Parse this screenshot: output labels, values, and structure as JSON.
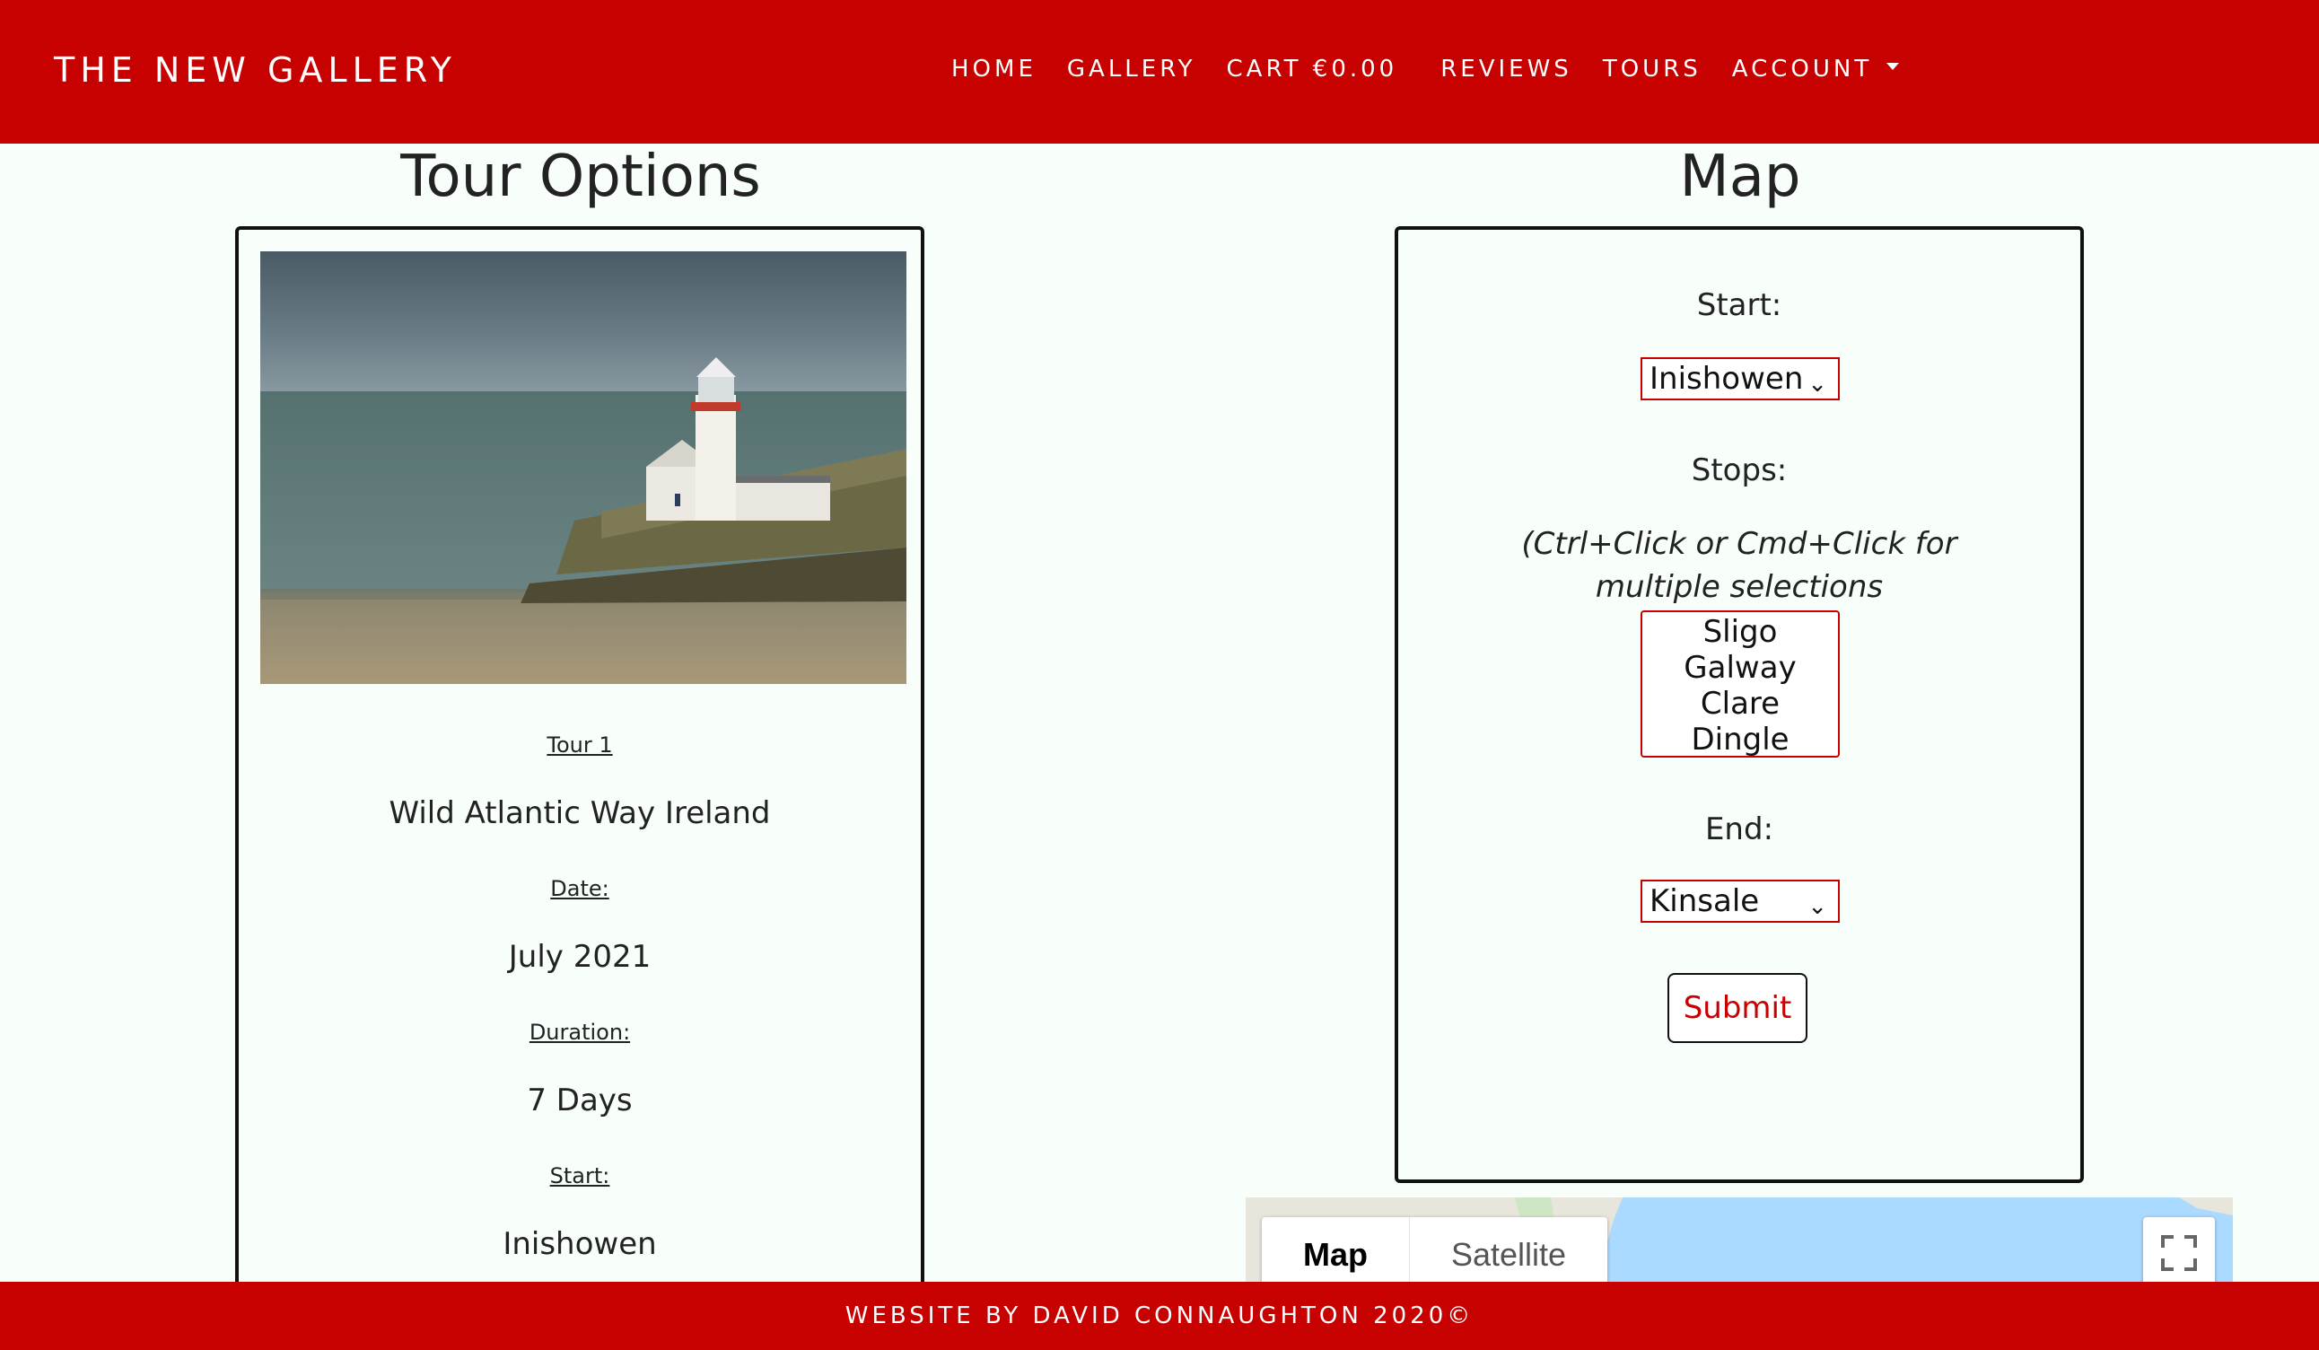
{
  "navbar": {
    "brand": "THE NEW GALLERY",
    "links": [
      {
        "label": "HOME"
      },
      {
        "label": "GALLERY"
      },
      {
        "label": "CART €0.00"
      },
      {
        "label": "REVIEWS"
      },
      {
        "label": "TOURS"
      },
      {
        "label": "ACCOUNT"
      }
    ],
    "account_icon": "caret-down-icon"
  },
  "tour_options": {
    "heading": "Tour Options",
    "photo_icon": "lighthouse-photo",
    "tour_label": "Tour 1",
    "tour_name": "Wild Atlantic Way Ireland",
    "date_label": "Date:",
    "date_value": "July 2021",
    "duration_label": "Duration:",
    "duration_value": "7 Days",
    "start_label": "Start:",
    "start_value": "Inishowen"
  },
  "map_section": {
    "heading": "Map",
    "start_label": "Start:",
    "start_selected": "Inishowen",
    "stops_label": "Stops:",
    "stops_hint": "(Ctrl+Click or Cmd+Click for multiple selections",
    "stops_options": [
      "Sligo",
      "Galway",
      "Clare",
      "Dingle"
    ],
    "end_label": "End:",
    "end_selected": "Kinsale",
    "submit_label": "Submit"
  },
  "google_map": {
    "type_map": "Map",
    "type_satellite": "Satellite",
    "fullscreen_icon": "fullscreen-icon"
  },
  "footer": {
    "text": "WEBSITE BY DAVID CONNAUGHTON 2020©"
  },
  "colors": {
    "brand_red": "#c70000",
    "page_bg": "#f8fffa",
    "map_water": "#aadaff"
  }
}
